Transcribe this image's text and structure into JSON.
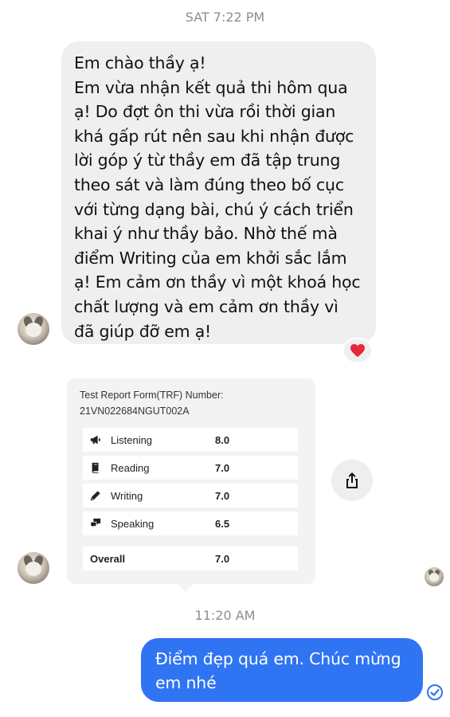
{
  "timestamps": {
    "first": "SAT 7:22 PM",
    "second": "11:20 AM"
  },
  "incoming_message": {
    "text": "Em chào thầy ạ!\nEm vừa nhận kết quả thi hôm qua ạ! Do đợt ôn thi vừa rồi thời gian khá gấp rút nên sau khi nhận được lời góp ý từ thầy em đã tập trung theo sát và làm đúng theo bố cục với từng dạng bài, chú ý cách triển khai ý như thầy bảo. Nhờ thế mà điểm Writing của em khởi sắc lắm ạ! Em cảm ơn thầy vì một khoá học chất lượng và em cảm ơn thầy vì đã giúp đỡ em ạ!",
    "reaction_icon": "heart-icon"
  },
  "score_card": {
    "trf_label": "Test Report Form(TRF) Number:",
    "trf_number": "21VN022684NGUT002A",
    "rows": [
      {
        "icon": "megaphone-icon",
        "name": "Listening",
        "score": "8.0"
      },
      {
        "icon": "book-icon",
        "name": "Reading",
        "score": "7.0"
      },
      {
        "icon": "pencil-icon",
        "name": "Writing",
        "score": "7.0"
      },
      {
        "icon": "chat-bubbles-icon",
        "name": "Speaking",
        "score": "6.5"
      }
    ],
    "overall": {
      "name": "Overall",
      "score": "7.0"
    }
  },
  "outgoing_message": {
    "text": "Điểm đẹp quá em. Chúc mừng\nem nhé",
    "status_icon": "sent-check-icon"
  },
  "colors": {
    "outgoing_bubble": "#2f74f2",
    "incoming_bubble": "#efefef",
    "heart": "#e8263c",
    "timestamp": "#8a8d91"
  }
}
